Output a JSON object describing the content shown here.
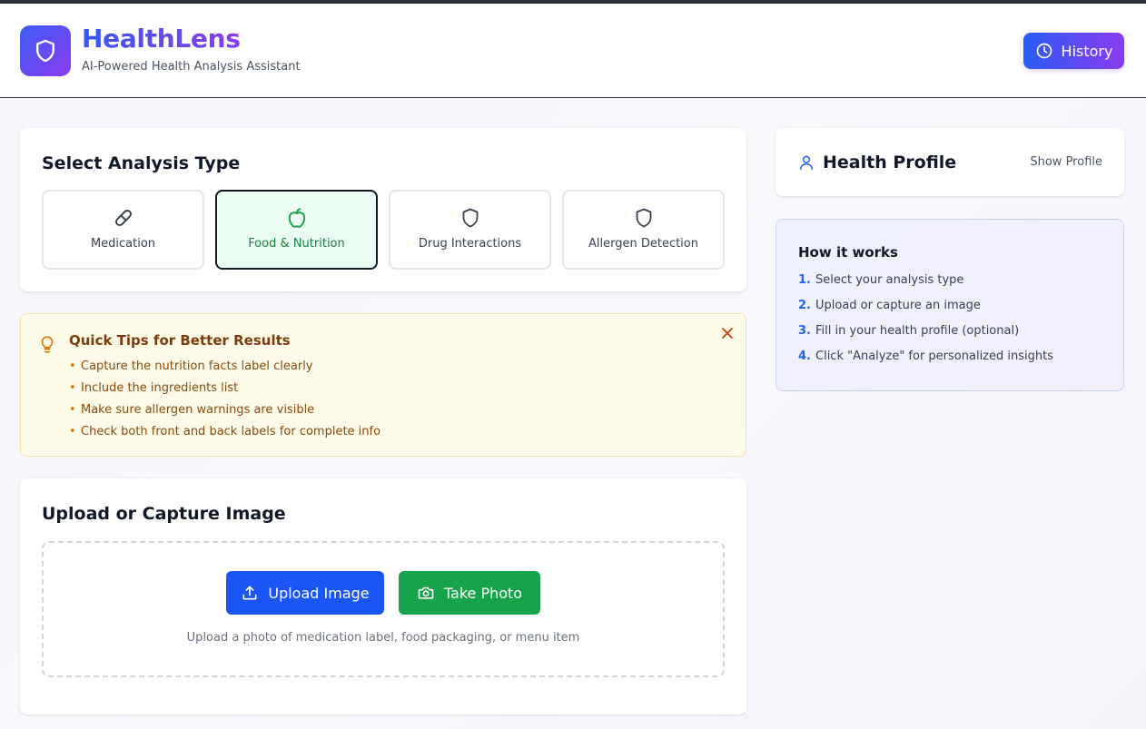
{
  "app": {
    "name": "HealthLens",
    "subtitle": "AI-Powered Health Analysis Assistant",
    "history_label": "History"
  },
  "analysis": {
    "title": "Select Analysis Type",
    "types": [
      {
        "label": "Medication",
        "icon": "pill-icon",
        "selected": false
      },
      {
        "label": "Food & Nutrition",
        "icon": "apple-icon",
        "selected": true
      },
      {
        "label": "Drug Interactions",
        "icon": "shield-icon",
        "selected": false
      },
      {
        "label": "Allergen Detection",
        "icon": "shield-icon",
        "selected": false
      }
    ]
  },
  "tips": {
    "title": "Quick Tips for Better Results",
    "items": [
      "Capture the nutrition facts label clearly",
      "Include the ingredients list",
      "Make sure allergen warnings are visible",
      "Check both front and back labels for complete info"
    ],
    "icon": "lightbulb-icon"
  },
  "upload": {
    "title": "Upload or Capture Image",
    "upload_label": "Upload Image",
    "photo_label": "Take Photo",
    "hint": "Upload a photo of medication label, food packaging, or menu item"
  },
  "profile": {
    "title": "Health Profile",
    "toggle_label": "Show Profile"
  },
  "how_it_works": {
    "title": "How it works",
    "steps": [
      {
        "num": "1.",
        "text": "Select your analysis type"
      },
      {
        "num": "2.",
        "text": "Upload or capture an image"
      },
      {
        "num": "3.",
        "text": "Fill in your health profile (optional)"
      },
      {
        "num": "4.",
        "text": "Click \"Analyze\" for personalized insights"
      }
    ]
  },
  "colors": {
    "brand_start": "#3c5cf7",
    "brand_end": "#8b3cf0",
    "upload_button": "#1a56f5",
    "photo_button": "#16a34a",
    "selected_bg": "#ecfdf3",
    "tips_bg": "#fefbe8"
  }
}
